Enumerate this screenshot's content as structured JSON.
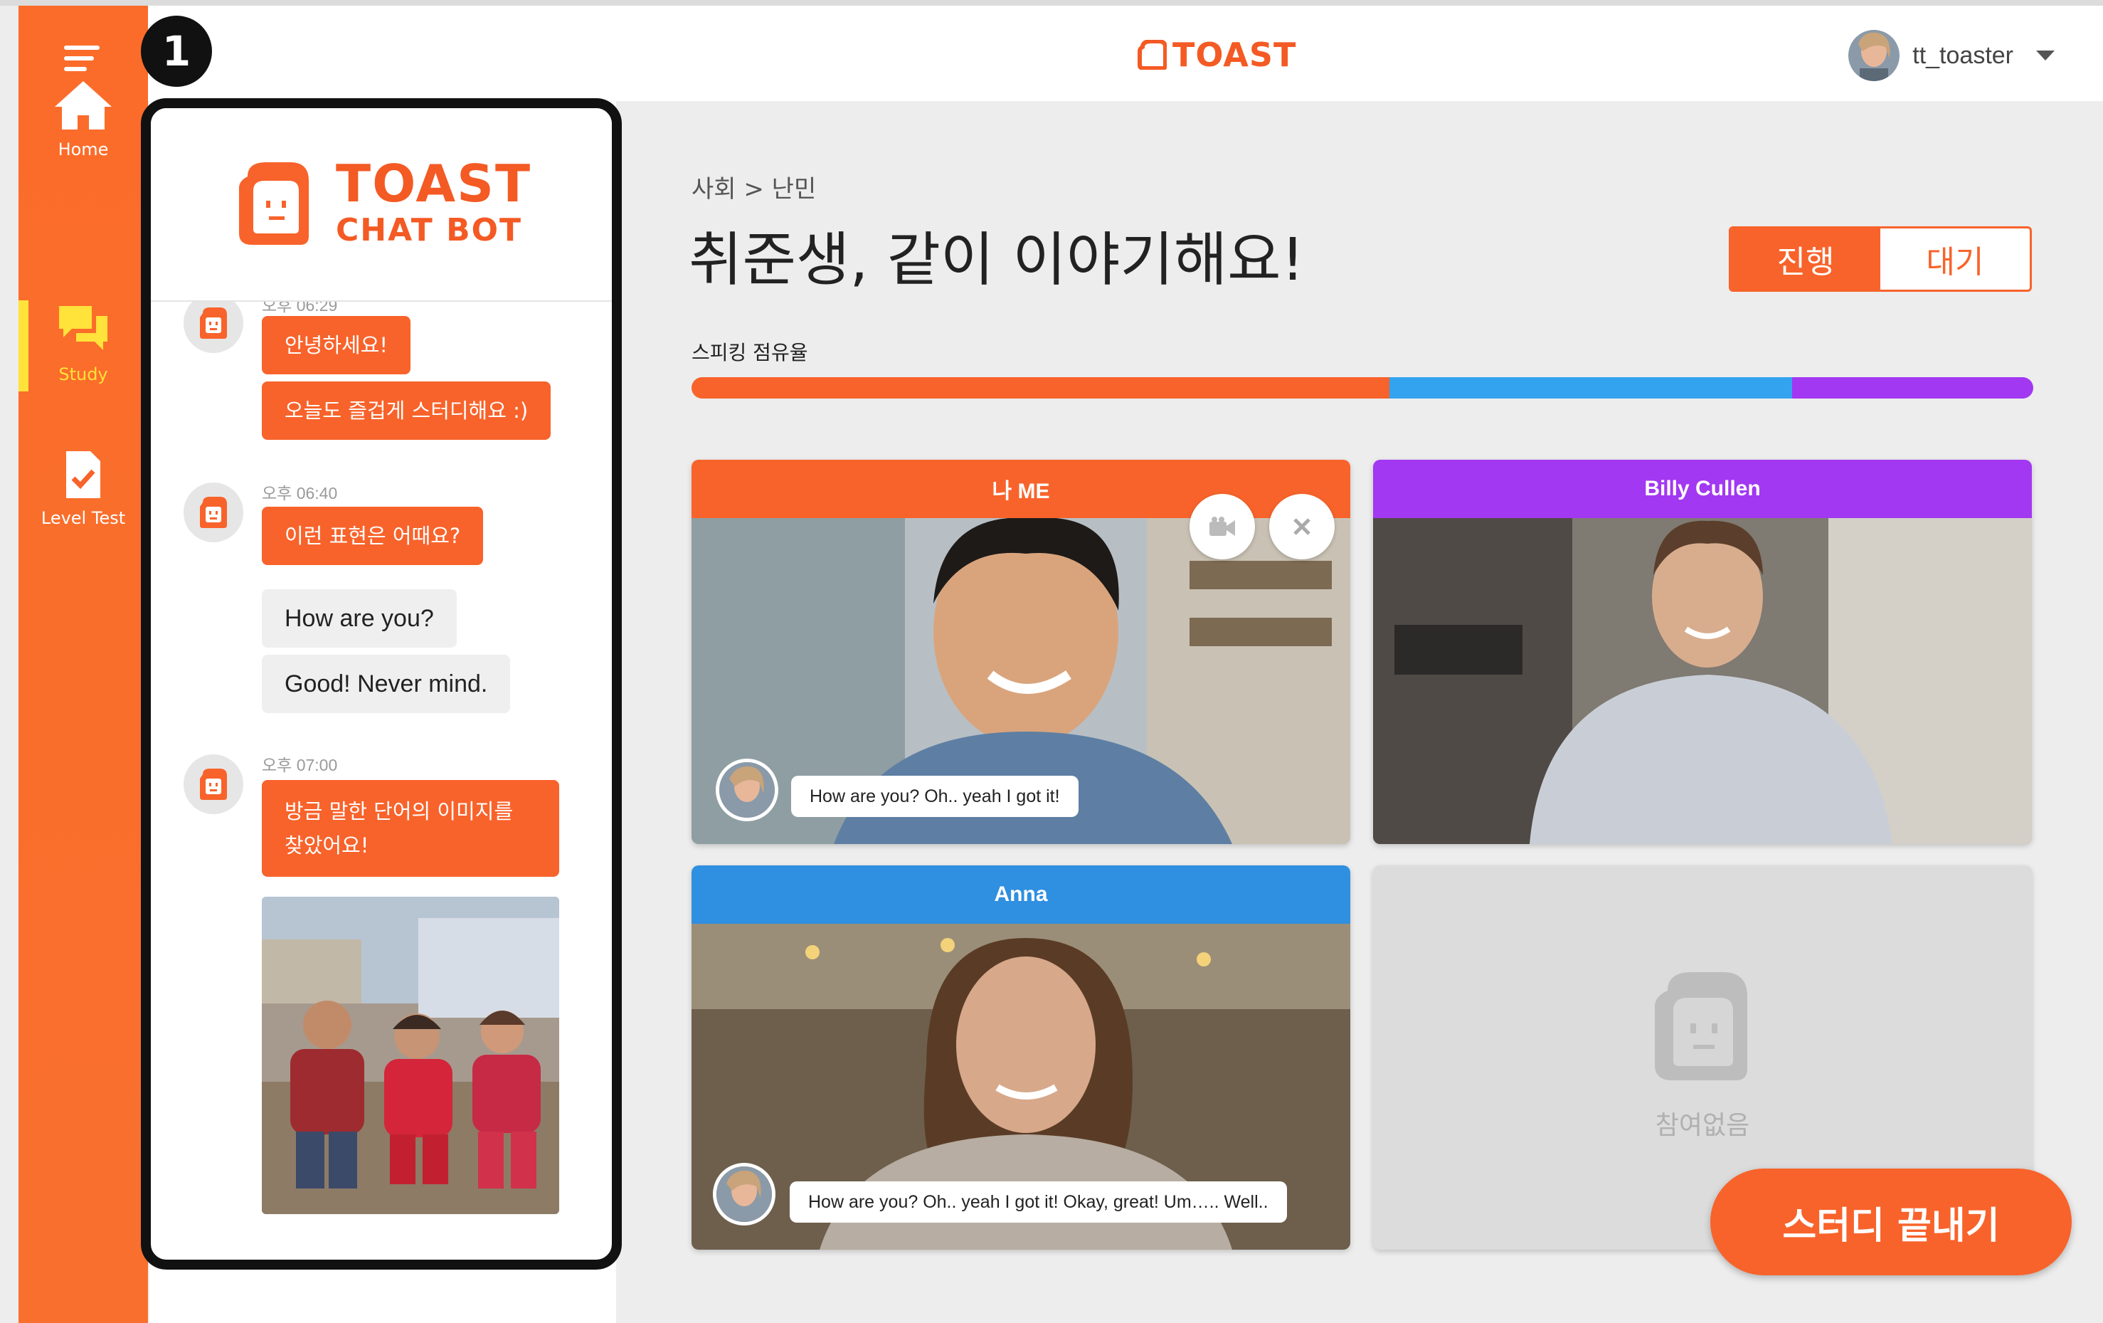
{
  "header": {
    "logo_text": "TOAST",
    "username": "tt_toaster"
  },
  "sidebar": {
    "items": [
      {
        "label": "Home",
        "icon": "home-icon"
      },
      {
        "label": "Study",
        "icon": "chat-bubbles-icon"
      },
      {
        "label": "Level Test",
        "icon": "checklist-doc-icon"
      }
    ],
    "active": "Study"
  },
  "annotation": {
    "marker": "1"
  },
  "chatbot": {
    "title_line1": "TOAST",
    "title_line2": "CHAT BOT",
    "messages": [
      {
        "time": "오후 06:29",
        "bubbles": [
          "안녕하세요!",
          "오늘도 즐겁게 스터디해요 :)"
        ]
      },
      {
        "time": "오후 06:40",
        "bubbles": [
          "이런 표현은 어때요?"
        ]
      },
      {
        "user_bubbles": [
          "How are you?",
          "Good! Never mind."
        ]
      },
      {
        "time": "오후 07:00",
        "bubbles": [
          "방금 말한 단어의 이미지를 찾았어요!"
        ]
      }
    ]
  },
  "main": {
    "breadcrumb": "사회 > 난민",
    "title": "취준생, 같이 이야기해요!",
    "toggle": {
      "active": "진행",
      "inactive": "대기"
    },
    "speaking_share_label": "스피킹 점유율",
    "speaking_share": [
      {
        "name": "나 ME",
        "value": 0.52,
        "color": "#f8632b"
      },
      {
        "name": "Billy Cullen",
        "value": 0.3,
        "color": "#33a3f0"
      },
      {
        "name": "Anna",
        "value": 0.18,
        "color": "#a238f2"
      }
    ],
    "participants": [
      {
        "name": "나 ME",
        "bar_color": "#f8632b",
        "caption": "How are you? Oh.. yeah I got it!"
      },
      {
        "name": "Billy Cullen",
        "bar_color": "#a238f2"
      },
      {
        "name": "Anna",
        "bar_color": "#2f8fe0",
        "caption": "How are you? Oh.. yeah I got it! Okay, great! Um….. Well.."
      },
      {
        "name": "",
        "empty_label": "참여없음"
      }
    ],
    "end_button": "스터디 끝내기"
  },
  "colors": {
    "accent": "#f8632b",
    "active_nav": "#ffe23a",
    "blue": "#33a3f0",
    "purple": "#a238f2"
  }
}
